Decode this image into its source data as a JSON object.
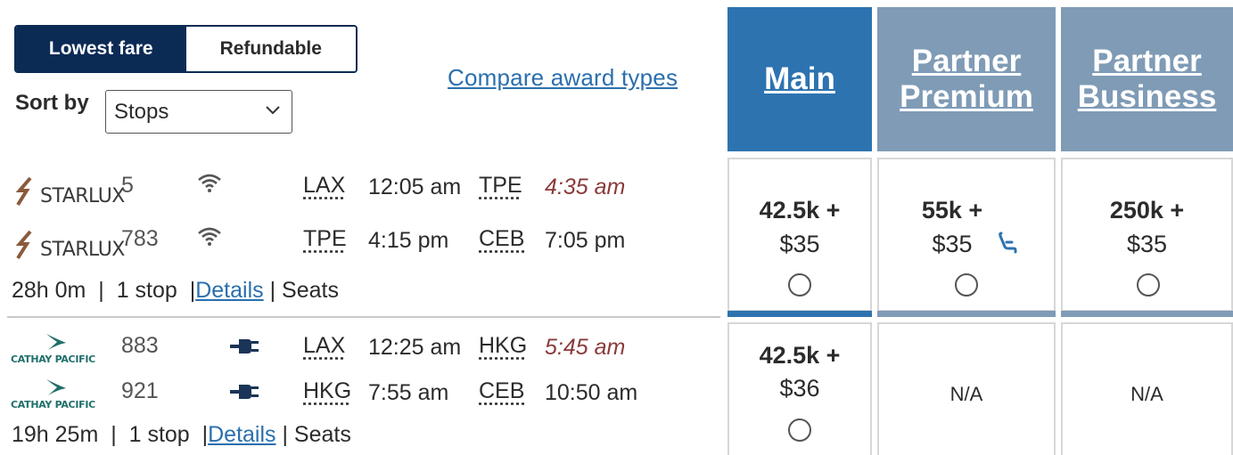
{
  "fare_toggle": {
    "options": [
      "Lowest fare",
      "Refundable"
    ],
    "selected": "Lowest fare"
  },
  "sort": {
    "label": "Sort by",
    "value": "Stops"
  },
  "compare_link": "Compare award types",
  "columns": {
    "main": {
      "line1": "Main",
      "line2": ""
    },
    "partner_premium": {
      "line1": "Partner",
      "line2": "Premium"
    },
    "partner_business": {
      "line1": "Partner",
      "line2": "Business"
    }
  },
  "colors": {
    "brand_navy": "#0b2b55",
    "main_blue": "#2d73b0",
    "partner_gray_blue": "#7f9bb6",
    "link_blue": "#2a6fae",
    "arrival_red": "#8a3a3a"
  },
  "results": [
    {
      "segments": [
        {
          "airline": "STARLUX",
          "flight": "5",
          "amenity_icon": "wifi-icon",
          "from": "LAX",
          "depart": "12:05 am",
          "to": "TPE",
          "arrive": "4:35 am",
          "arrive_highlight": true
        },
        {
          "airline": "STARLUX",
          "flight": "783",
          "amenity_icon": "wifi-icon",
          "from": "TPE",
          "depart": "4:15 pm",
          "to": "CEB",
          "arrive": "7:05 pm",
          "arrive_highlight": false
        }
      ],
      "duration": "28h 0m",
      "stops": "1 stop",
      "details_label": "Details",
      "seats_label": "Seats",
      "fares": {
        "main": {
          "points": "42.5k +",
          "cash": "$35"
        },
        "partner_premium": {
          "points": "55k +",
          "cash": "$35",
          "icon": "seat-icon"
        },
        "partner_business": {
          "points": "250k +",
          "cash": "$35"
        }
      }
    },
    {
      "segments": [
        {
          "airline": "CATHAY PACIFIC",
          "flight": "883",
          "amenity_icon": "power-plug-icon",
          "from": "LAX",
          "depart": "12:25 am",
          "to": "HKG",
          "arrive": "5:45 am",
          "arrive_highlight": true
        },
        {
          "airline": "CATHAY PACIFIC",
          "flight": "921",
          "amenity_icon": "power-plug-icon",
          "from": "HKG",
          "depart": "7:55 am",
          "to": "CEB",
          "arrive": "10:50 am",
          "arrive_highlight": false
        }
      ],
      "duration": "19h 25m",
      "stops": "1 stop",
      "details_label": "Details",
      "seats_label": "Seats",
      "fares": {
        "main": {
          "points": "42.5k +",
          "cash": "$36"
        },
        "partner_premium": {
          "na": "N/A"
        },
        "partner_business": {
          "na": "N/A"
        }
      }
    }
  ]
}
